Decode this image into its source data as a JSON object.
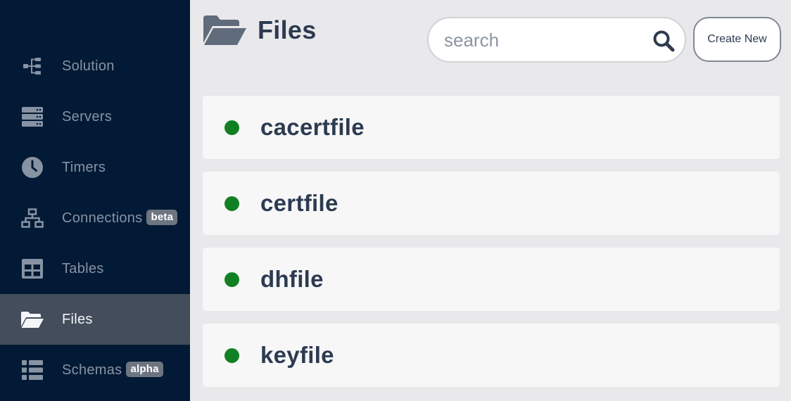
{
  "sidebar": {
    "items": [
      {
        "label": "Solution",
        "icon": "hierarchy-icon",
        "badge": "",
        "active": false
      },
      {
        "label": "Servers",
        "icon": "server-stack-icon",
        "badge": "",
        "active": false
      },
      {
        "label": "Timers",
        "icon": "clock-icon",
        "badge": "",
        "active": false
      },
      {
        "label": "Connections",
        "icon": "network-icon",
        "badge": "beta",
        "active": false
      },
      {
        "label": "Tables",
        "icon": "table-icon",
        "badge": "",
        "active": false
      },
      {
        "label": "Files",
        "icon": "folder-open-icon",
        "badge": "",
        "active": true
      },
      {
        "label": "Schemas",
        "icon": "list-icon",
        "badge": "alpha",
        "active": false
      }
    ]
  },
  "header": {
    "title": "Files",
    "icon": "folder-open-icon"
  },
  "search": {
    "placeholder": "search",
    "value": ""
  },
  "actions": {
    "create_label": "Create New"
  },
  "files": [
    {
      "name": "cacertfile",
      "status_color": "#118022"
    },
    {
      "name": "certfile",
      "status_color": "#118022"
    },
    {
      "name": "dhfile",
      "status_color": "#118022"
    },
    {
      "name": "keyfile",
      "status_color": "#118022"
    }
  ],
  "colors": {
    "sidebar_bg": "#031a36",
    "sidebar_active_bg": "#434d5b",
    "content_bg": "#e9e9ec",
    "card_bg": "#f7f7f8",
    "text_primary": "#2d3b50",
    "status_ok": "#118022"
  }
}
